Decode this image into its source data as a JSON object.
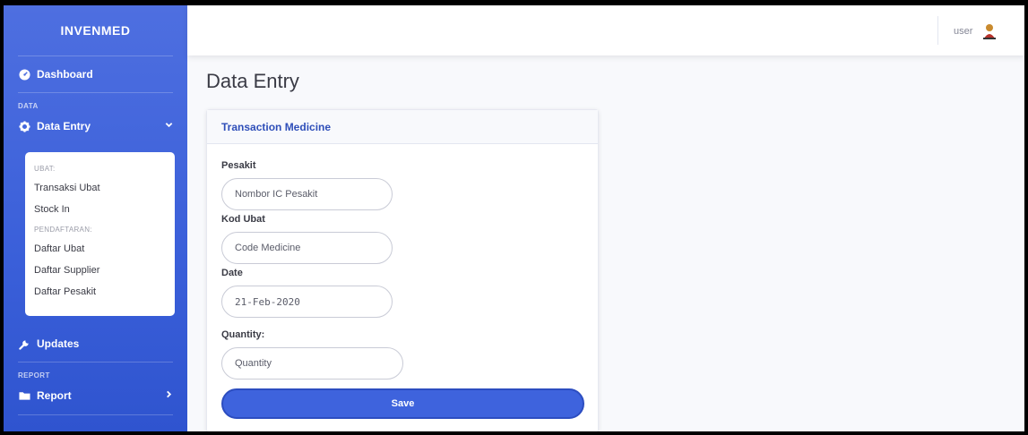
{
  "sidebar": {
    "brand": "INVENMED",
    "dashboard": "Dashboard",
    "heading_data": "DATA",
    "data_entry": "Data Entry",
    "submenu": {
      "heading_ubat": "UBAT:",
      "items_ubat": [
        "Transaksi Ubat",
        "Stock In"
      ],
      "heading_pendaftaran": "PENDAFTARAN:",
      "items_pendaftaran": [
        "Daftar Ubat",
        "Daftar Supplier",
        "Daftar Pesakit"
      ]
    },
    "updates": "Updates",
    "heading_report": "REPORT",
    "report": "Report"
  },
  "topbar": {
    "user": "user"
  },
  "main": {
    "page_title": "Data Entry",
    "card_title": "Transaction Medicine",
    "fields": {
      "pesakit_label": "Pesakit",
      "pesakit_placeholder": "Nombor IC Pesakit",
      "kod_ubat_label": "Kod Ubat",
      "kod_ubat_placeholder": "Code Medicine",
      "date_label": "Date",
      "date_value": "21-Feb-2020",
      "quantity_label": "Quantity:",
      "quantity_placeholder": "Quantity"
    },
    "save_label": "Save"
  },
  "colors": {
    "sidebar_primary": "#4e6fe0",
    "accent": "#3e63dd",
    "card_title": "#2f4fb9"
  },
  "icons": {
    "dashboard": "tachometer-icon",
    "data_entry": "gear-icon",
    "updates": "wrench-icon",
    "report": "folder-icon",
    "expand": "chevron-down-icon",
    "collapse": "chevron-right-icon",
    "avatar": "user-avatar-icon"
  }
}
